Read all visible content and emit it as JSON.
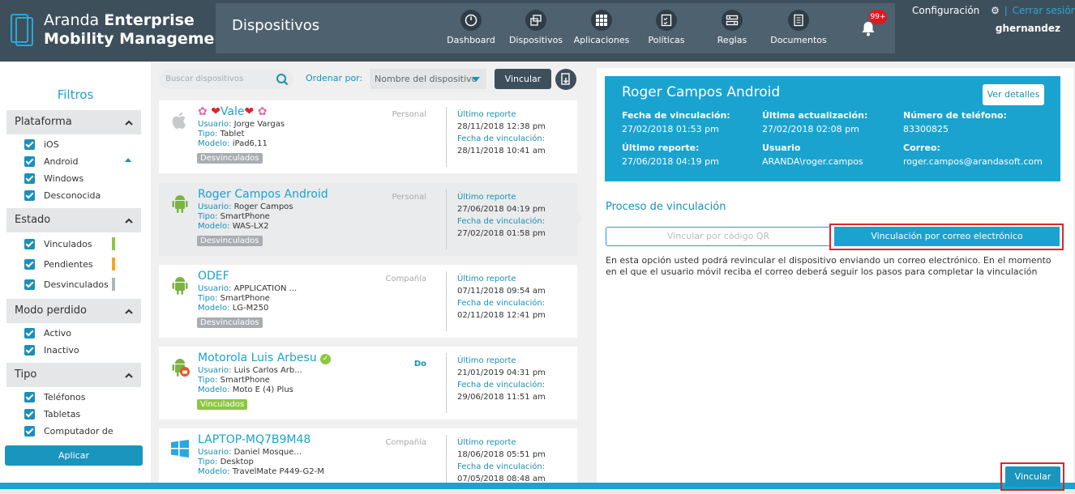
{
  "brand": {
    "line1_light": "Aranda ",
    "line1_bold": "Enterprise",
    "line2": "Mobility Management"
  },
  "section_title": "Dispositivos",
  "nav": [
    {
      "label": "Dashboard",
      "icon": "dashboard-icon"
    },
    {
      "label": "Dispositivos",
      "icon": "devices-icon"
    },
    {
      "label": "Aplicaciones",
      "icon": "apps-grid-icon"
    },
    {
      "label": "Políticas",
      "icon": "policy-checklist-icon"
    },
    {
      "label": "Reglas",
      "icon": "rules-icon"
    },
    {
      "label": "Documentos",
      "icon": "document-icon"
    }
  ],
  "notifications": {
    "badge": "99+"
  },
  "header": {
    "config": "Configuración",
    "logout": "Cerrar sesión",
    "separator": "|",
    "user": "ghernandez"
  },
  "filters": {
    "title": "Filtros",
    "groups": [
      {
        "title": "Plataforma",
        "items": [
          "iOS",
          "Android",
          "Windows",
          "Desconocida"
        ]
      },
      {
        "title": "Estado",
        "items": [
          "Vinculados",
          "Pendientes",
          "Desvinculados"
        ]
      },
      {
        "title": "Modo perdido",
        "items": [
          "Activo",
          "Inactivo"
        ]
      },
      {
        "title": "Tipo",
        "items": [
          "Teléfonos",
          "Tabletas",
          "Computador de"
        ]
      }
    ],
    "apply": "Aplicar",
    "status_colors": [
      "#8dc63f",
      "#f5a623",
      "#b0b4b8"
    ]
  },
  "toolbar": {
    "search_placeholder": "Buscar dispositivos",
    "sort_label": "Ordenar por:",
    "sort_value": "Nombre del dispositivo",
    "vincular": "Vincular"
  },
  "labels": {
    "usuario": "Usuario:",
    "tipo": "Tipo:",
    "modelo": "Modelo:",
    "ultimo_reporte": "Último reporte",
    "fecha_vinculacion": "Fecha de vinculación:"
  },
  "devices": [
    {
      "name": "Vale",
      "user": "Jorge Vargas",
      "type": "Tablet",
      "model": "iPad6,11",
      "status": "Desvinculados",
      "status_color": "#a9adb1",
      "ownership": "Personal",
      "last_report": "28/11/2018 12:38 pm",
      "link_date": "28/11/2018 10:41 am",
      "platform": "apple"
    },
    {
      "name": "Roger Campos Android",
      "user": "Roger Campos",
      "type": "SmartPhone",
      "model": "WAS-LX2",
      "status": "Desvinculados",
      "status_color": "#a9adb1",
      "ownership": "Personal",
      "last_report": "27/06/2018 04:19 pm",
      "link_date": "27/02/2018 01:58 pm",
      "platform": "android"
    },
    {
      "name": "ODEF",
      "user": "APPLICATION ...",
      "type": "SmartPhone",
      "model": "LG-M250",
      "status": "Desvinculados",
      "status_color": "#a9adb1",
      "ownership": "Compañía",
      "last_report": "07/11/2018 09:54 am",
      "link_date": "02/11/2018 12:41 pm",
      "platform": "android"
    },
    {
      "name": "Motorola Luis Arbesu",
      "user": "Luis Carlos Arb...",
      "type": "SmartPhone",
      "model": "Moto E (4) Plus",
      "status": "Vinculados",
      "status_color": "#8dc63f",
      "ownership": "Do",
      "last_report": "21/01/2019 04:31 pm",
      "link_date": "29/06/2018 11:51 am",
      "platform": "android-work"
    },
    {
      "name": "LAPTOP-MQ7B9M48",
      "user": "Daniel Mosque...",
      "type": "Desktop",
      "model": "TravelMate P449-G2-M",
      "status": "",
      "status_color": "#a9adb1",
      "ownership": "Compañía",
      "last_report": "18/06/2018 05:51 pm",
      "link_date": "07/05/2018 08:48 am",
      "platform": "windows"
    }
  ],
  "detail": {
    "title": "Roger Campos Android",
    "details_button": "Ver detalles",
    "fields": [
      {
        "label": "Fecha de vinculación:",
        "value": "27/02/2018 01:53 pm"
      },
      {
        "label": "Última actualización:",
        "value": "27/02/2018 02:08 pm"
      },
      {
        "label": "Número de teléfono:",
        "value": "83300825"
      },
      {
        "label": "Último reporte:",
        "value": "27/06/2018 04:19 pm"
      },
      {
        "label": "Usuario",
        "value": "ARANDA\\roger.campos"
      },
      {
        "label": "Correo:",
        "value": "roger.campos@arandasoft.com"
      }
    ],
    "process_title": "Proceso de vinculación",
    "tab_qr": "Vincular por código QR",
    "tab_email": "Vinculación por correo electrónico",
    "description": "En esta opción usted podrá revincular el dispositivo enviando un correo electrónico. En el momento en el que el usuario móvil reciba el correo deberá seguir los pasos para completar la vinculación",
    "vincular_button": "Vincular"
  },
  "colors": {
    "accent": "#1aa3cf",
    "header": "#3e4f5c",
    "highlight": "#d9262e"
  }
}
